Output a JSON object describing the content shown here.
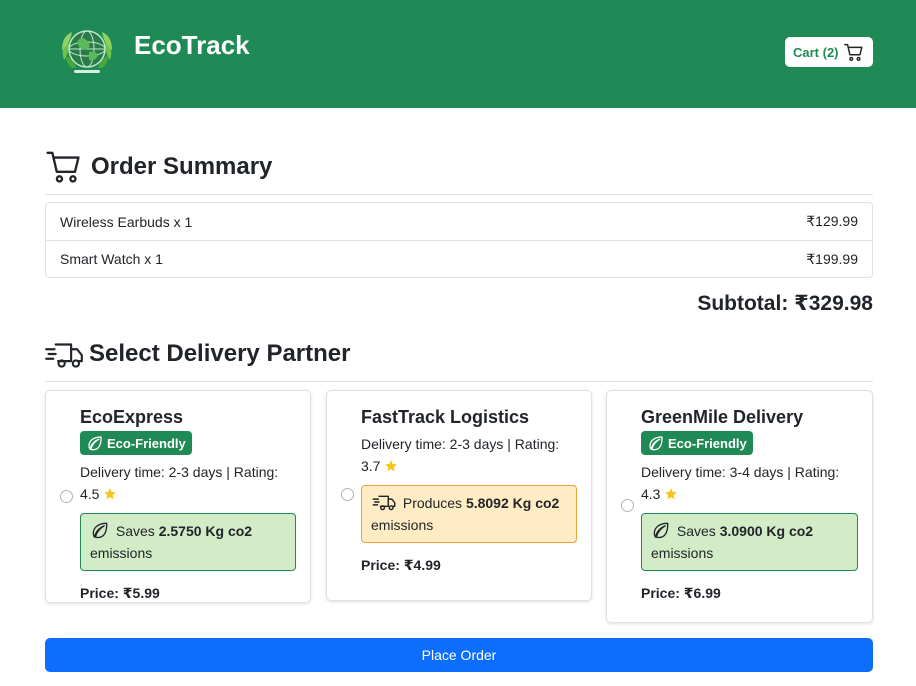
{
  "header": {
    "brand": "EcoTrack",
    "cart_label": "Cart (2)",
    "background_color": "#1f8a55"
  },
  "order_summary": {
    "title": "Order Summary",
    "items": [
      {
        "name": "Wireless Earbuds x 1",
        "price": "₹129.99"
      },
      {
        "name": "Smart Watch x 1",
        "price": "₹199.99"
      }
    ],
    "subtotal": "Subtotal: ₹329.98"
  },
  "delivery": {
    "title": "Select Delivery Partner",
    "partners": [
      {
        "name": "EcoExpress",
        "badge": "Eco-Friendly",
        "info": "Delivery time: 2-3 days | Rating: 4.5",
        "emission_verb": "Saves",
        "emission_amount": "2.5750 Kg co2",
        "emission_suffix": "emissions",
        "price": "Price: ₹5.99",
        "selected": false
      },
      {
        "name": "FastTrack Logistics",
        "badge": "",
        "info": "Delivery time: 2-3 days | Rating: 3.7",
        "emission_verb": "Produces",
        "emission_amount": "5.8092 Kg co2",
        "emission_suffix": "emissions",
        "price": "Price: ₹4.99",
        "selected": false
      },
      {
        "name": "GreenMile Delivery",
        "badge": "Eco-Friendly",
        "info": "Delivery time: 3-4 days | Rating: 4.3",
        "emission_verb": "Saves",
        "emission_amount": "3.0900 Kg co2",
        "emission_suffix": "emissions",
        "price": "Price: ₹6.99",
        "selected": false
      }
    ]
  },
  "place_order_label": "Place Order",
  "icons": {
    "logo": "globe-leaves-logo",
    "cart": "cart-icon",
    "summary": "cart-icon",
    "delivery": "truck-icon",
    "leaf": "leaf-icon",
    "star": "star-icon"
  },
  "colors": {
    "primary_green": "#1f8a55",
    "primary_blue": "#0d6efd",
    "eco_box": "#d1ecc6",
    "emission_box": "#ffecc4",
    "star": "#f5c518"
  }
}
